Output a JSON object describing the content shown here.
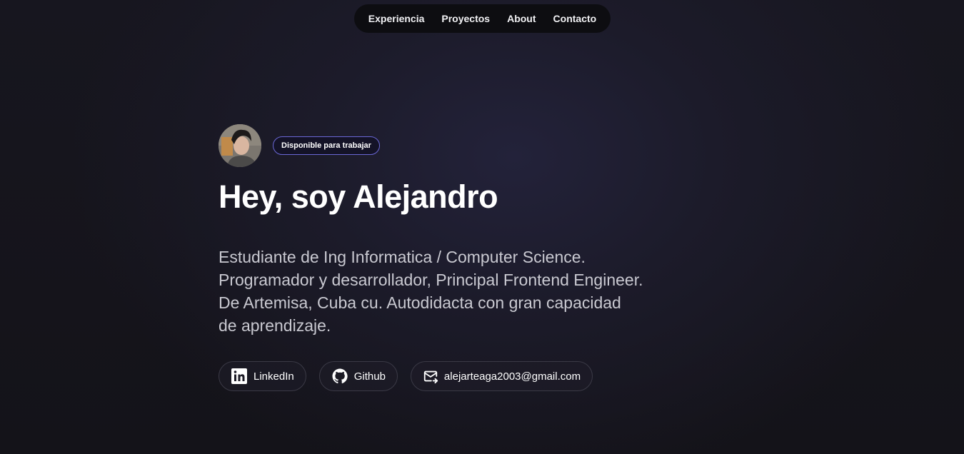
{
  "nav": {
    "items": [
      {
        "label": "Experiencia"
      },
      {
        "label": "Proyectos"
      },
      {
        "label": "About"
      },
      {
        "label": "Contacto"
      }
    ]
  },
  "hero": {
    "availability_badge": "Disponible para trabajar",
    "title": "Hey, soy Alejandro",
    "bio_lines": [
      "Estudiante de Ing Informatica / Computer Science.",
      "Programador y desarrollador, Principal Frontend Engineer.",
      "De Artemisa, Cuba cu. Autodidacta con gran capacidad",
      "de aprendizaje."
    ]
  },
  "links": [
    {
      "label": "LinkedIn",
      "icon": "linkedin-icon"
    },
    {
      "label": "Github",
      "icon": "github-icon"
    },
    {
      "label": "alejarteaga2003@gmail.com",
      "icon": "mail-icon"
    }
  ],
  "colors": {
    "background": "#151419",
    "badge_border": "#6a67d6",
    "text_primary": "#ffffff",
    "text_secondary": "#c9c9d1"
  }
}
